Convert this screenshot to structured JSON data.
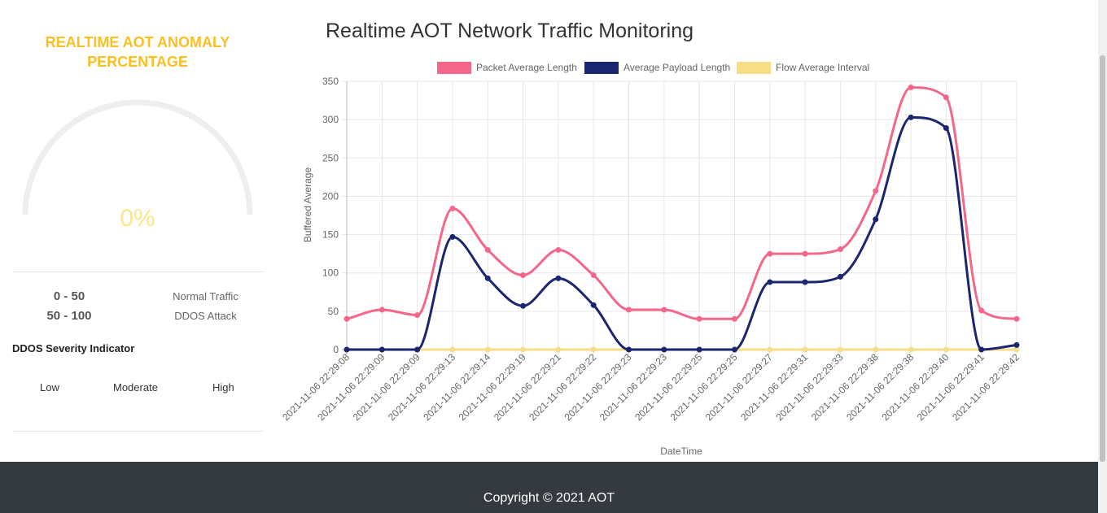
{
  "gauge": {
    "title_line1": "REALTIME AOT ANOMALY",
    "title_line2": "PERCENTAGE",
    "value_text": "0%",
    "value": 0
  },
  "legend_ranges": [
    {
      "range": "0 - 50",
      "label": "Normal Traffic"
    },
    {
      "range": "50 - 100",
      "label": "DDOS Attack"
    }
  ],
  "severity": {
    "title": "DDOS Severity Indicator",
    "levels": [
      "Low",
      "Moderate",
      "High"
    ]
  },
  "chart": {
    "title": "Realtime AOT Network Traffic Monitoring"
  },
  "footer": {
    "copyright": "Copyright © 2021 AOT"
  },
  "colors": {
    "accent_gold": "#fbbf24",
    "series_pink": "#f4668a",
    "series_navy": "#1a2670",
    "series_yellow": "#f7dd85",
    "footer_bg": "#343a40"
  },
  "chart_data": {
    "type": "line",
    "xlabel": "DateTime",
    "ylabel": "Buffered Average",
    "ylim": [
      0,
      350
    ],
    "yticks": [
      0,
      50,
      100,
      150,
      200,
      250,
      300,
      350
    ],
    "grid": true,
    "legend_position": "top",
    "x": [
      "2021-11-06 22:29:08",
      "2021-11-06 22:29:09",
      "2021-11-06 22:29:09",
      "2021-11-06 22:29:13",
      "2021-11-06 22:29:14",
      "2021-11-06 22:29:19",
      "2021-11-06 22:29:21",
      "2021-11-06 22:29:22",
      "2021-11-06 22:29:23",
      "2021-11-06 22:29:23",
      "2021-11-06 22:29:25",
      "2021-11-06 22:29:25",
      "2021-11-06 22:29:27",
      "2021-11-06 22:29:31",
      "2021-11-06 22:29:33",
      "2021-11-06 22:29:38",
      "2021-11-06 22:29:38",
      "2021-11-06 22:29:40",
      "2021-11-06 22:29:41",
      "2021-11-06 22:29:42"
    ],
    "series": [
      {
        "name": "Packet Average Length",
        "color": "#f4668a",
        "values": [
          40,
          52,
          45,
          184,
          130,
          97,
          130,
          97,
          52,
          52,
          40,
          40,
          125,
          125,
          131,
          207,
          342,
          329,
          51,
          40
        ]
      },
      {
        "name": "Average Payload Length",
        "color": "#1a2670",
        "values": [
          0,
          0,
          0,
          147,
          93,
          57,
          93,
          58,
          0,
          0,
          0,
          0,
          88,
          88,
          95,
          170,
          303,
          289,
          0,
          6
        ]
      },
      {
        "name": "Flow Average Interval",
        "color": "#f7dd85",
        "values": [
          0,
          0,
          0,
          0,
          0,
          0,
          0,
          0,
          0,
          0,
          0,
          0,
          0,
          0,
          0,
          0,
          0,
          0,
          0,
          0
        ]
      }
    ]
  }
}
